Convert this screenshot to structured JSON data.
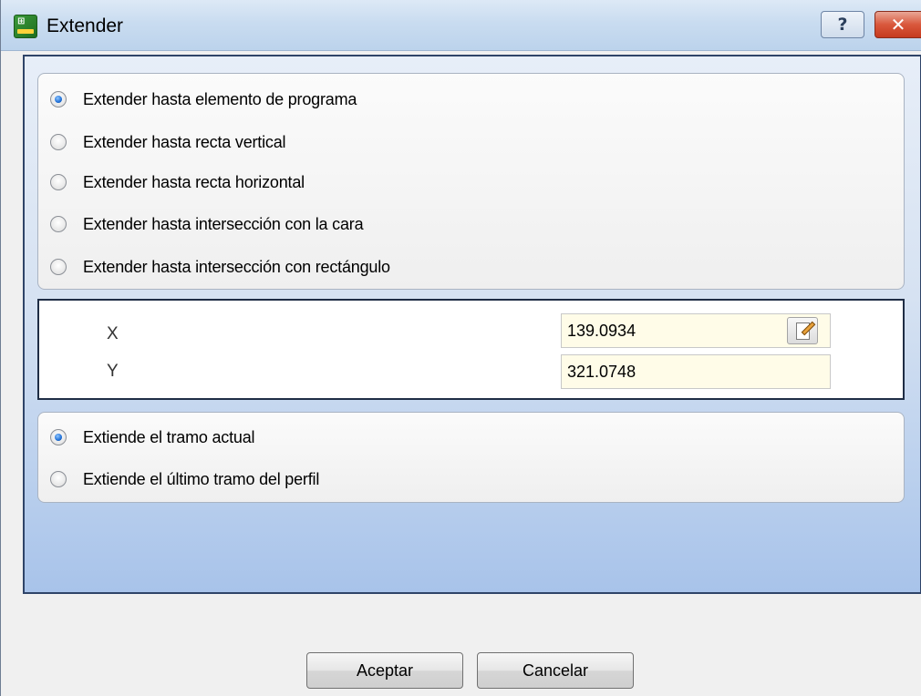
{
  "window": {
    "title": "Extender",
    "help_label": "?",
    "close_label": "✕"
  },
  "extend_mode": {
    "options": [
      {
        "label": "Extender hasta elemento de programa",
        "checked": true
      },
      {
        "label": "Extender hasta recta vertical",
        "checked": false
      },
      {
        "label": "Extender hasta recta horizontal",
        "checked": false
      },
      {
        "label": "Extender hasta intersección con la cara",
        "checked": false
      },
      {
        "label": "Extender hasta intersección con rectángulo",
        "checked": false
      }
    ]
  },
  "coords": {
    "x_label": "X",
    "x_value": "139.0934",
    "y_label": "Y",
    "y_value": "321.0748",
    "edit_icon": "edit-note-icon"
  },
  "segment": {
    "options": [
      {
        "label": "Extiende el tramo actual",
        "checked": true
      },
      {
        "label": "Extiende el último tramo del perfil",
        "checked": false
      }
    ]
  },
  "buttons": {
    "ok_label": "Aceptar",
    "cancel_label": "Cancelar"
  },
  "colors": {
    "panel_border": "#2f4468",
    "input_bg": "#fffce8",
    "radio_checked": "#1f6fd6"
  }
}
